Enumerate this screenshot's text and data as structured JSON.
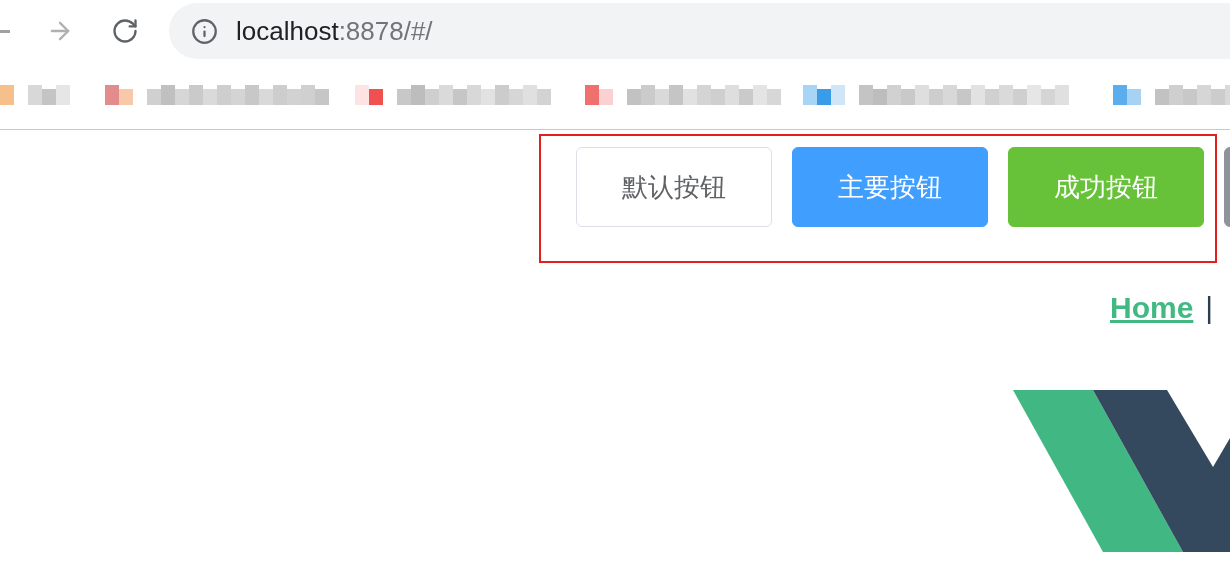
{
  "browser": {
    "nav": [
      {
        "kind": "back",
        "disabled": false
      },
      {
        "kind": "forward",
        "disabled": true
      },
      {
        "kind": "reload",
        "disabled": false
      }
    ],
    "address": {
      "host": "localhost",
      "path": ":8878/#/"
    }
  },
  "buttons": [
    {
      "label": "默认按钮",
      "kind": "default"
    },
    {
      "label": "主要按钮",
      "kind": "primary"
    },
    {
      "label": "成功按钮",
      "kind": "success"
    },
    {
      "kind": "info"
    }
  ],
  "nav_links": [
    {
      "label": "Home",
      "kind": "link"
    },
    {
      "label": "|",
      "kind": "separator"
    }
  ]
}
